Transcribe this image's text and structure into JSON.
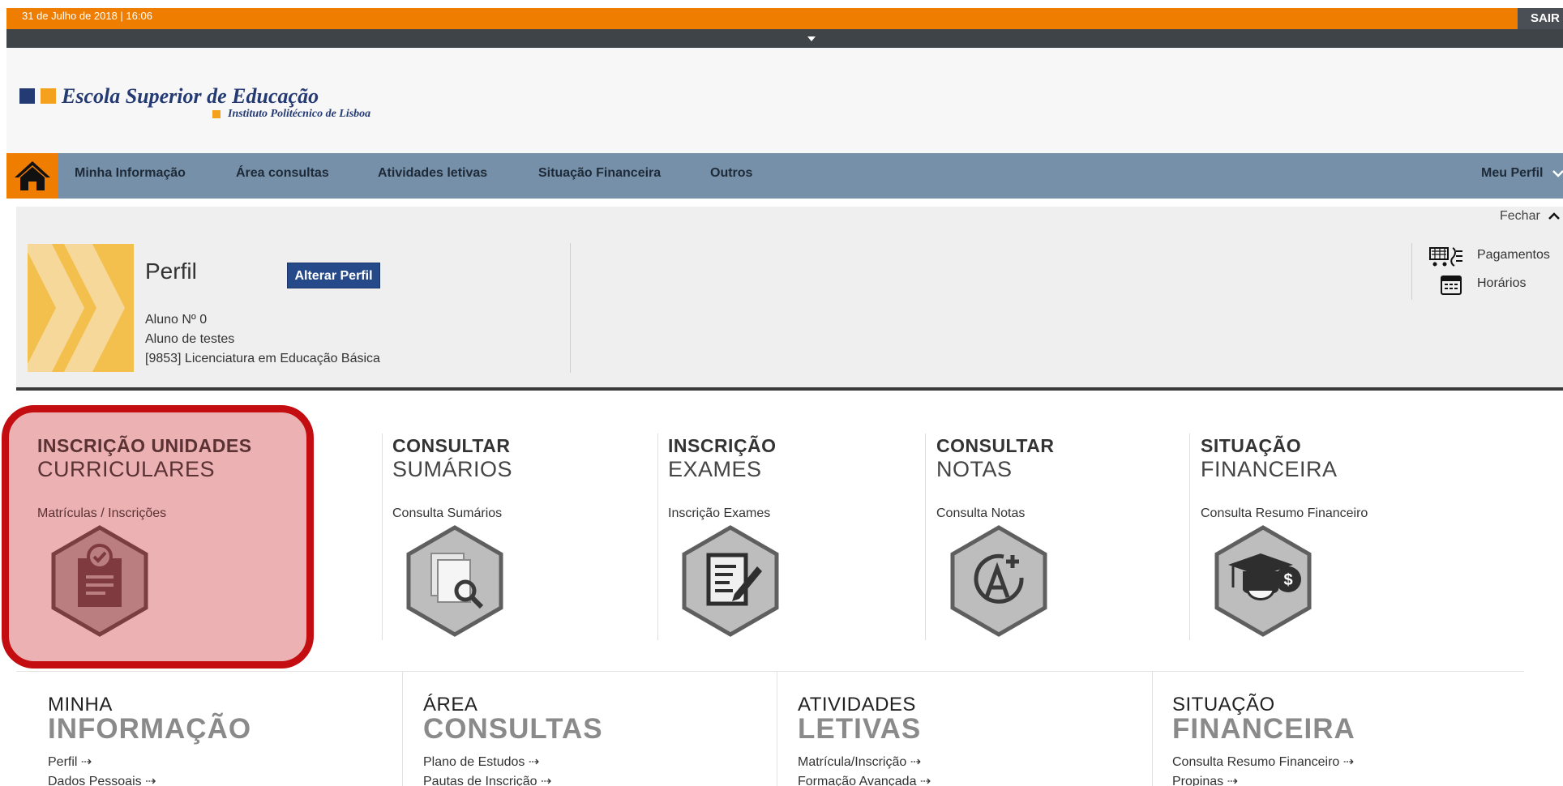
{
  "topbar": {
    "datetime": "31 de Julho de 2018 | 16:06",
    "logout_label": "SAIR"
  },
  "logo": {
    "title": "Escola Superior de Educação",
    "subtitle": "Instituto Politécnico de Lisboa"
  },
  "nav": {
    "items": [
      {
        "label": "Minha Informação"
      },
      {
        "label": "Área consultas"
      },
      {
        "label": "Atividades letivas"
      },
      {
        "label": "Situação Financeira"
      },
      {
        "label": "Outros"
      }
    ],
    "profile_label": "Meu Perfil"
  },
  "profile": {
    "close_label": "Fechar",
    "title": "Perfil",
    "edit_label": "Alterar Perfil",
    "student_number": "Aluno Nº 0",
    "student_name": "Aluno de testes",
    "course": "[9853] Licenciatura em Educação Básica",
    "shortcuts": [
      {
        "label": "Pagamentos",
        "icon": "payments-icon"
      },
      {
        "label": "Horários",
        "icon": "calendar-icon"
      }
    ]
  },
  "tiles": [
    {
      "title1": "INSCRIÇÃO UNIDADES",
      "title2": "CURRICULARES",
      "link": "Matrículas / Inscrições",
      "icon": "enrollment-icon"
    },
    {
      "title1": "CONSULTAR",
      "title2": "SUMÁRIOS",
      "link": "Consulta Sumários",
      "icon": "summaries-icon"
    },
    {
      "title1": "INSCRIÇÃO",
      "title2": "EXAMES",
      "link": "Inscrição Exames",
      "icon": "exams-icon"
    },
    {
      "title1": "CONSULTAR",
      "title2": "NOTAS",
      "link": "Consulta Notas",
      "icon": "grades-icon"
    },
    {
      "title1": "SITUAÇÃO",
      "title2": "FINANCEIRA",
      "link": "Consulta Resumo Financeiro",
      "icon": "finance-icon"
    }
  ],
  "sections": [
    {
      "title1": "MINHA",
      "title2": "INFORMAÇÃO",
      "links": [
        "Perfil",
        "Dados Pessoais"
      ]
    },
    {
      "title1": "ÁREA",
      "title2": "CONSULTAS",
      "links": [
        "Plano de Estudos",
        "Pautas de Inscrição"
      ]
    },
    {
      "title1": "ATIVIDADES",
      "title2": "LETIVAS",
      "links": [
        "Matrícula/Inscrição",
        "Formação Avançada"
      ]
    },
    {
      "title1": "SITUAÇÃO",
      "title2": "FINANCEIRA",
      "links": [
        "Consulta Resumo Financeiro",
        "Propinas"
      ]
    }
  ],
  "colors": {
    "orange": "#ef7d00",
    "nav": "#7590a8",
    "navy": "#243a73",
    "highlight": "#c30d10"
  }
}
